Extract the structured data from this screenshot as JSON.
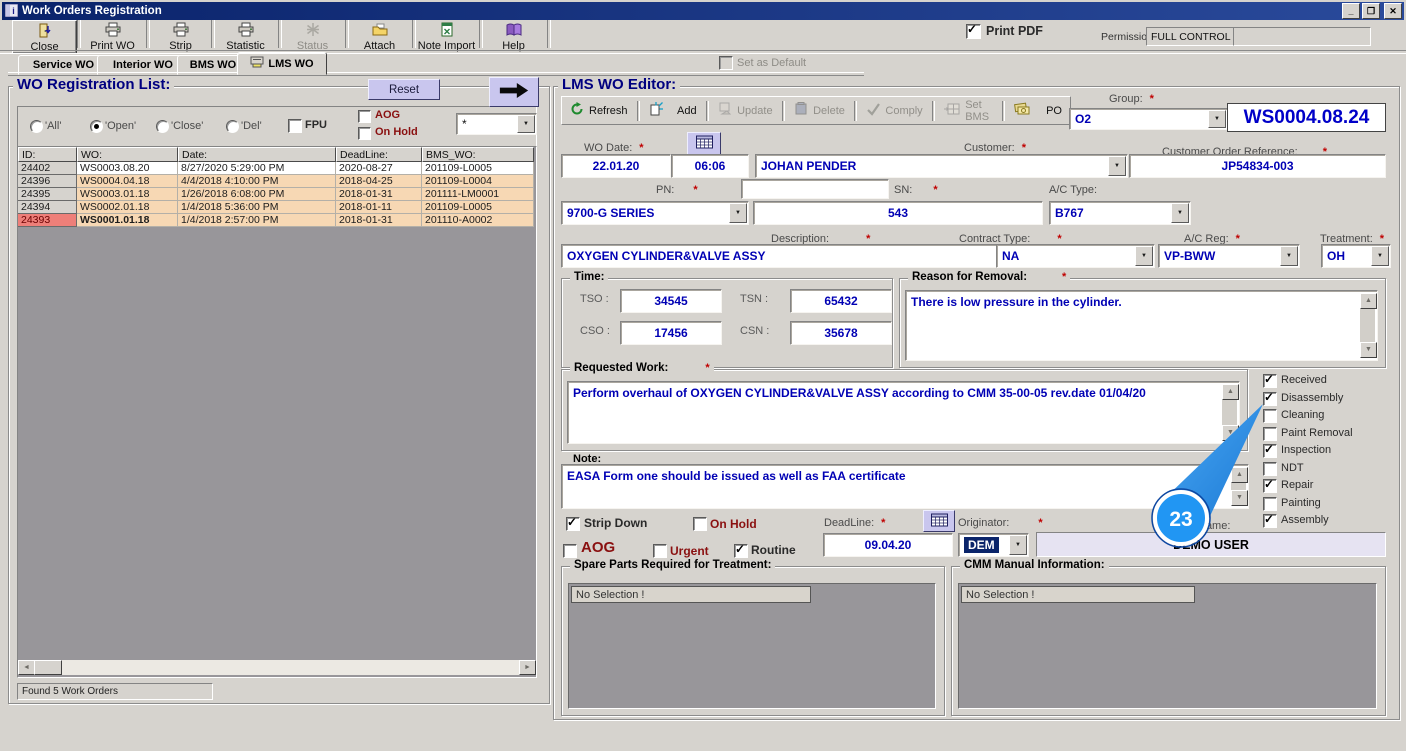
{
  "window": {
    "title": "Work Orders Registration"
  },
  "icons": {
    "minimize": "_",
    "restore": "❒",
    "close": "✕",
    "dropdown": "▼",
    "up": "▲",
    "down": "▼",
    "left": "◄",
    "right": "►",
    "check": "✓"
  },
  "toolbar": {
    "buttons": [
      {
        "label": "Close",
        "icon": "exit-door-icon",
        "enabled": true
      },
      {
        "label": "Print WO",
        "icon": "printer-icon",
        "enabled": true
      },
      {
        "label": "Strip",
        "icon": "printer-icon",
        "enabled": true
      },
      {
        "label": "Statistic",
        "icon": "printer-icon",
        "enabled": true
      },
      {
        "label": "Status",
        "icon": "burst-icon",
        "enabled": false
      },
      {
        "label": "Attach",
        "icon": "folder-icon",
        "enabled": true
      },
      {
        "label": "Note Import",
        "icon": "sheet-icon",
        "enabled": true
      },
      {
        "label": "Help",
        "icon": "book-icon",
        "enabled": true
      }
    ],
    "print_pdf": "Print PDF",
    "permission_label": "Permission:",
    "permission_value": "FULL CONTROL"
  },
  "tabs": {
    "items": [
      {
        "label": "Service WO"
      },
      {
        "label": "Interior WO"
      },
      {
        "label": "BMS WO"
      },
      {
        "label": "LMS WO"
      }
    ],
    "set_as_default": "Set as Default"
  },
  "wo_list": {
    "title": "WO Registration List:",
    "reset": "Reset",
    "radios": [
      {
        "label": "'All'",
        "selected": false
      },
      {
        "label": "'Open'",
        "selected": true
      },
      {
        "label": "'Close'",
        "selected": false
      },
      {
        "label": "'Del'",
        "selected": false
      }
    ],
    "fpu": "FPU",
    "aog": "AOG",
    "on_hold": "On Hold",
    "filter_value": "*",
    "headers": [
      "ID:",
      "WO:",
      "Date:",
      "DeadLine:",
      "BMS_WO:"
    ],
    "rows": [
      {
        "id": "24402",
        "wo": "WS0003.08.20",
        "date": "8/27/2020 5:29:00 PM",
        "deadline": "2020-08-27",
        "bms": "201109-L0005",
        "selected": false
      },
      {
        "id": "24396",
        "wo": "WS0004.04.18",
        "date": "4/4/2018 4:10:00 PM",
        "deadline": "2018-04-25",
        "bms": "201109-L0004",
        "selected": false
      },
      {
        "id": "24395",
        "wo": "WS0003.01.18",
        "date": "1/26/2018 6:08:00 PM",
        "deadline": "2018-01-31",
        "bms": "201111-LM0001",
        "selected": false
      },
      {
        "id": "24394",
        "wo": "WS0002.01.18",
        "date": "1/4/2018 5:36:00 PM",
        "deadline": "2018-01-11",
        "bms": "201109-L0005",
        "selected": false
      },
      {
        "id": "24393",
        "wo": "WS0001.01.18",
        "date": "1/4/2018 2:57:00 PM",
        "deadline": "2018-01-31",
        "bms": "201110-A0002",
        "selected": true
      }
    ],
    "status": "Found 5 Work Orders"
  },
  "editor": {
    "title": "LMS WO Editor:",
    "toolbar": [
      {
        "label": "Refresh",
        "icon": "refresh-icon",
        "enabled": true
      },
      {
        "label": "Add",
        "icon": "add-icon",
        "enabled": true
      },
      {
        "label": "Update",
        "icon": "update-icon",
        "enabled": false
      },
      {
        "label": "Delete",
        "icon": "delete-icon",
        "enabled": false
      },
      {
        "label": "Comply",
        "icon": "check-icon",
        "enabled": false
      },
      {
        "label": "Set BMS",
        "icon": "grid-icon",
        "enabled": false
      },
      {
        "label": "PO",
        "icon": "money-icon",
        "enabled": true
      }
    ],
    "required_marker": "*",
    "group_label": "Group:",
    "group_value": "O2",
    "ws_number": "WS0004.08.24",
    "wo_date_label": "WO Date:",
    "wo_date": "22.01.20",
    "wo_time": "06:06",
    "customer_label": "Customer:",
    "customer": "JOHAN PENDER",
    "cor_label": "Customer Order Reference:",
    "cor": "JP54834-003",
    "pn_label": "PN:",
    "pn": "9700-G SERIES",
    "sn_label": "SN:",
    "sn": "543",
    "ac_type_label": "A/C Type:",
    "ac_type": "B767",
    "description_label": "Description:",
    "description": "OXYGEN CYLINDER&VALVE ASSY",
    "contract_label": "Contract Type:",
    "contract": "NA",
    "ac_reg_label": "A/C Reg:",
    "ac_reg": "VP-BWW",
    "treatment_label": "Treatment:",
    "treatment": "OH",
    "time_title": "Time:",
    "tso_label": "TSO :",
    "tso": "34545",
    "tsn_label": "TSN :",
    "tsn": "65432",
    "cso_label": "CSO :",
    "cso": "17456",
    "csn_label": "CSN :",
    "csn": "35678",
    "reason_title": "Reason for Removal:",
    "reason": "There is low pressure in the cylinder.",
    "requested_title": "Requested Work:",
    "requested": "Perform overhaul of OXYGEN CYLINDER&VALVE ASSY according to CMM 35-00-05 rev.date 01/04/20",
    "note_title": "Note:",
    "note": "EASA Form one should be issued as well as FAA certificate",
    "stages": [
      {
        "label": "Received",
        "checked": true
      },
      {
        "label": "Disassembly",
        "checked": true
      },
      {
        "label": "Cleaning",
        "checked": false
      },
      {
        "label": "Paint Removal",
        "checked": false
      },
      {
        "label": "Inspection",
        "checked": true
      },
      {
        "label": "NDT",
        "checked": false
      },
      {
        "label": "Repair",
        "checked": true
      },
      {
        "label": "Painting",
        "checked": false
      },
      {
        "label": "Assembly",
        "checked": true
      }
    ],
    "strip_down": "Strip Down",
    "on_hold": "On Hold",
    "aog": "AOG",
    "urgent": "Urgent",
    "routine": "Routine",
    "deadline_label": "DeadLine:",
    "deadline": "09.04.20",
    "originator_label": "Originator:",
    "originator": "DEM",
    "name_label": "Name:",
    "name_value": "DEMO USER",
    "spare_title": "Spare Parts Required for Treatment:",
    "spare_value": "No Selection !",
    "cmm_title": "CMM Manual Information:",
    "cmm_value": "No Selection !"
  },
  "annotation": {
    "number": "23",
    "color": "#2196f3"
  },
  "colors": {
    "row_highlight": "#f7d8b4",
    "selected_id": "#ee7f79",
    "value_text": "#0000b4",
    "lavender": "#c9c6ee",
    "titlebar": "#0a236b"
  }
}
